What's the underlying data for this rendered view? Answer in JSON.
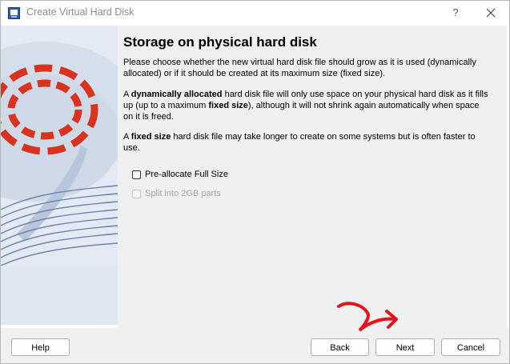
{
  "window": {
    "title": "Create Virtual Hard Disk",
    "help_icon_label": "?",
    "app_icon": "virtualbox-app-icon",
    "close_icon": "close-icon"
  },
  "page": {
    "title": "Storage on physical hard disk",
    "intro": "Please choose whether the new virtual hard disk file should grow as it is used (dynamically allocated) or if it should be created at its maximum size (fixed size).",
    "dynamic_prefix": "A ",
    "dynamic_bold": "dynamically allocated",
    "dynamic_mid": " hard disk file will only use space on your physical hard disk as it fills up (up to a maximum ",
    "dynamic_bold2": "fixed size",
    "dynamic_suffix": "), although it will not shrink again automatically when space on it is freed.",
    "fixed_prefix": "A ",
    "fixed_bold": "fixed size",
    "fixed_suffix": " hard disk file may take longer to create on some systems but is often faster to use."
  },
  "options": {
    "preallocate_label": "Pre-allocate Full Size",
    "preallocate_checked": false,
    "split_label": "Split into 2GB parts",
    "split_checked": false,
    "split_enabled": false
  },
  "buttons": {
    "help": "Help",
    "back": "Back",
    "next": "Next",
    "cancel": "Cancel"
  },
  "colors": {
    "accent_red": "#d9321f",
    "watermark_bg": "#dfe7f1",
    "annotation_red": "#e8111a"
  }
}
